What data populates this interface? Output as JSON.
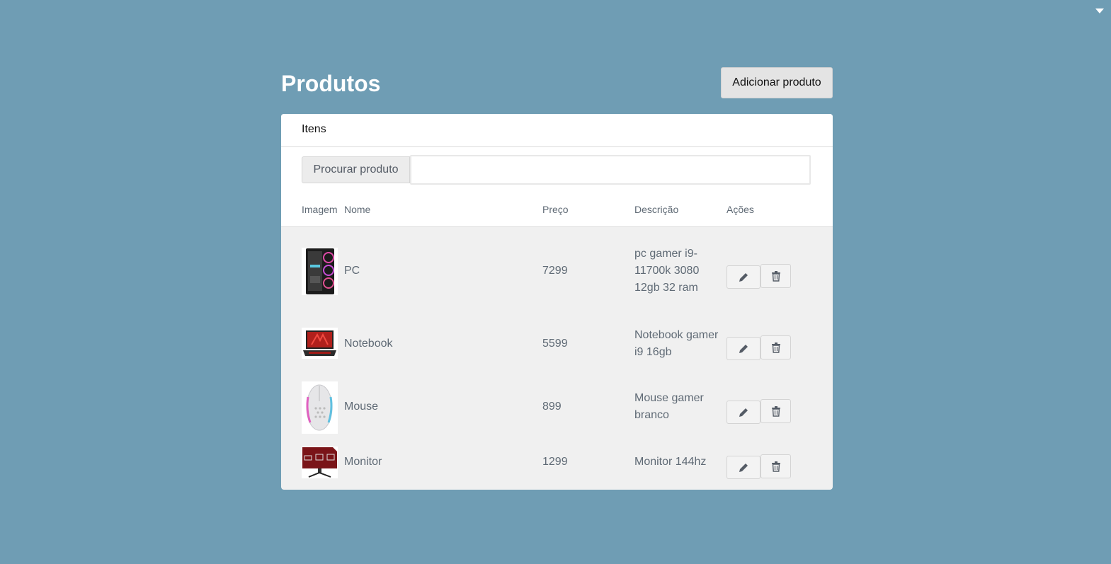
{
  "page": {
    "title": "Produtos",
    "add_button": "Adicionar produto"
  },
  "card": {
    "title": "Itens",
    "search_label": "Procurar produto",
    "search_value": ""
  },
  "table": {
    "headers": [
      "Imagem",
      "Nome",
      "Preço",
      "Descrição",
      "Ações"
    ],
    "rows": [
      {
        "image": "pc-case-image",
        "name": "PC",
        "price": "7299",
        "description": "pc gamer i9-11700k 3080 12gb 32 ram"
      },
      {
        "image": "notebook-image",
        "name": "Notebook",
        "price": "5599",
        "description": "Notebook gamer i9 16gb"
      },
      {
        "image": "mouse-image",
        "name": "Mouse",
        "price": "899",
        "description": "Mouse gamer branco"
      },
      {
        "image": "monitor-image",
        "name": "Monitor",
        "price": "1299",
        "description": "Monitor 144hz"
      }
    ],
    "row_actions": {
      "edit_icon": "pencil-icon",
      "delete_icon": "trash-icon"
    }
  },
  "colors": {
    "background": "#6f9db4",
    "card": "#f0f0f0",
    "text_muted": "#5f6a75"
  }
}
